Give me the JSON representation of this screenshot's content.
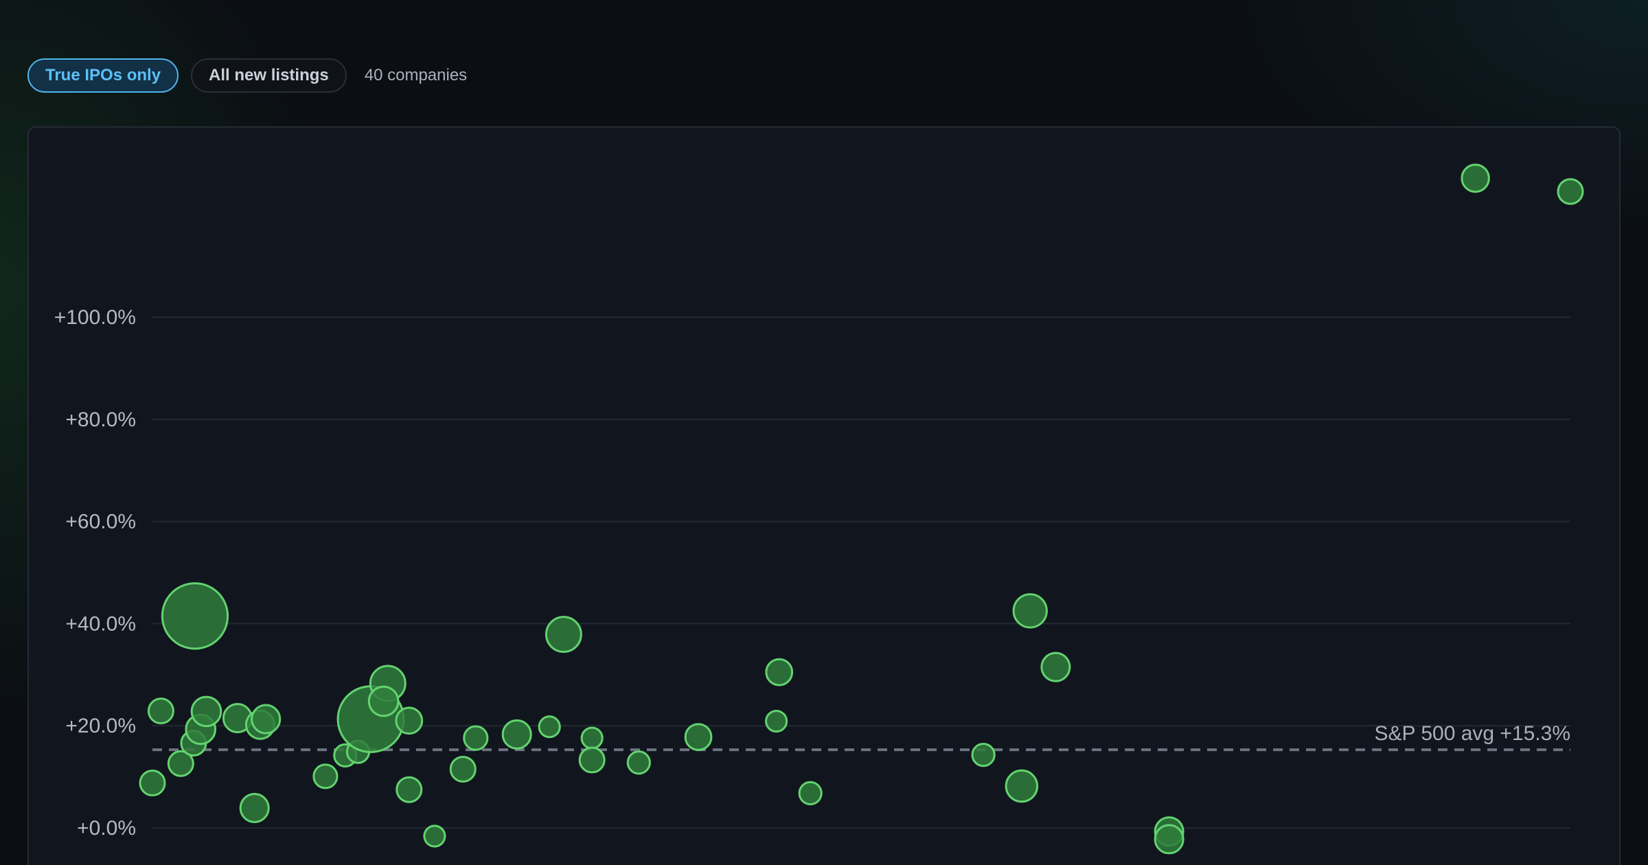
{
  "filters": {
    "true_ipos_label": "True IPOs only",
    "all_listings_label": "All new listings",
    "count_text": "40 companies",
    "active": "true_ipos"
  },
  "colors": {
    "bubble_fill": "#2f7d3c",
    "bubble_stroke": "#63d36f",
    "grid": "#222a33",
    "reference_line": "#6b7480",
    "active_pill": "#5cc0f7"
  },
  "chart_data": {
    "type": "scatter",
    "title": "",
    "xlabel": "",
    "ylabel": "",
    "x_range": [
      0,
      1
    ],
    "ylim": [
      0,
      100
    ],
    "y_ticks": [
      0,
      20,
      40,
      60,
      80,
      100
    ],
    "y_tick_labels": [
      "+0.0%",
      "+20.0%",
      "+40.0%",
      "+60.0%",
      "+80.0%",
      "+100.0%"
    ],
    "grid": true,
    "reference_line": {
      "value": 15.3,
      "label": "S&P 500 avg +15.3%",
      "style": "dashed"
    },
    "points": [
      {
        "x": 0.0,
        "y": 8.8,
        "size": 1.0
      },
      {
        "x": 0.006,
        "y": 22.9,
        "size": 1.0
      },
      {
        "x": 0.02,
        "y": 12.6,
        "size": 1.0
      },
      {
        "x": 0.029,
        "y": 16.6,
        "size": 1.0
      },
      {
        "x": 0.03,
        "y": 41.5,
        "size": 7.0
      },
      {
        "x": 0.034,
        "y": 19.3,
        "size": 1.4
      },
      {
        "x": 0.038,
        "y": 22.8,
        "size": 1.4
      },
      {
        "x": 0.06,
        "y": 21.5,
        "size": 1.3
      },
      {
        "x": 0.072,
        "y": 3.9,
        "size": 1.3
      },
      {
        "x": 0.076,
        "y": 20.2,
        "size": 1.3
      },
      {
        "x": 0.08,
        "y": 21.3,
        "size": 1.3
      },
      {
        "x": 0.122,
        "y": 10.1,
        "size": 0.9
      },
      {
        "x": 0.136,
        "y": 14.2,
        "size": 0.8
      },
      {
        "x": 0.145,
        "y": 14.9,
        "size": 0.8
      },
      {
        "x": 0.154,
        "y": 21.3,
        "size": 7.1
      },
      {
        "x": 0.166,
        "y": 28.3,
        "size": 2.0
      },
      {
        "x": 0.163,
        "y": 24.8,
        "size": 1.4
      },
      {
        "x": 0.181,
        "y": 21.0,
        "size": 1.1
      },
      {
        "x": 0.181,
        "y": 7.5,
        "size": 1.0
      },
      {
        "x": 0.199,
        "y": -1.6,
        "size": 0.7
      },
      {
        "x": 0.219,
        "y": 11.5,
        "size": 1.0
      },
      {
        "x": 0.228,
        "y": 17.6,
        "size": 0.9
      },
      {
        "x": 0.257,
        "y": 18.3,
        "size": 1.3
      },
      {
        "x": 0.28,
        "y": 19.8,
        "size": 0.7
      },
      {
        "x": 0.29,
        "y": 37.9,
        "size": 2.0
      },
      {
        "x": 0.31,
        "y": 17.6,
        "size": 0.7
      },
      {
        "x": 0.31,
        "y": 13.3,
        "size": 1.0
      },
      {
        "x": 0.343,
        "y": 12.8,
        "size": 0.8
      },
      {
        "x": 0.385,
        "y": 17.8,
        "size": 1.1
      },
      {
        "x": 0.44,
        "y": 20.9,
        "size": 0.7
      },
      {
        "x": 0.442,
        "y": 30.5,
        "size": 1.1
      },
      {
        "x": 0.464,
        "y": 6.8,
        "size": 0.8
      },
      {
        "x": 0.586,
        "y": 14.3,
        "size": 0.8
      },
      {
        "x": 0.613,
        "y": 8.2,
        "size": 1.6
      },
      {
        "x": 0.619,
        "y": 42.5,
        "size": 1.8
      },
      {
        "x": 0.637,
        "y": 31.5,
        "size": 1.3
      },
      {
        "x": 0.717,
        "y": -0.7,
        "size": 1.3
      },
      {
        "x": 0.717,
        "y": -2.2,
        "size": 1.3
      },
      {
        "x": 0.933,
        "y": 127.2,
        "size": 1.2
      },
      {
        "x": 1.0,
        "y": 124.6,
        "size": 1.0
      }
    ]
  }
}
